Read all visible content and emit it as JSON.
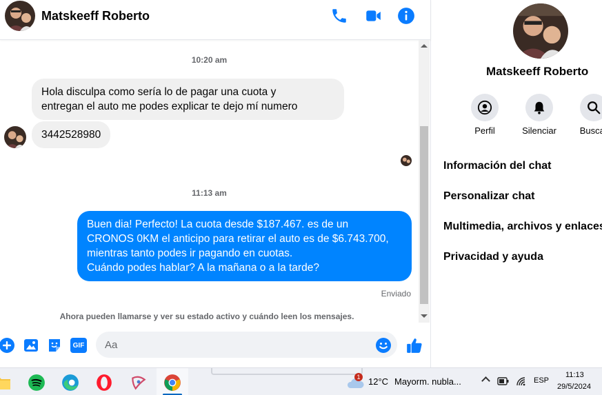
{
  "chat": {
    "contact_name": "Matskeeff Roberto",
    "header_icons": [
      "phone-icon",
      "video-camera-icon",
      "info-icon"
    ],
    "messages": [
      {
        "timestamp": "10:20 am"
      },
      {
        "direction": "incoming",
        "text_line1": "Hola disculpa como sería lo de pagar una cuota y",
        "text_line2": "entregan el auto me podes explicar te dejo mí numero"
      },
      {
        "direction": "incoming",
        "text": "3442528980"
      },
      {
        "timestamp": "11:13 am"
      },
      {
        "direction": "outgoing",
        "line1": "Buen dia! Perfecto! La cuota desde $187.467. es de un",
        "line2": "CRONOS 0KM el anticipo para retirar el auto es de $6.743.700,",
        "line3": "mientras tanto podes ir pagando en cuotas.",
        "line4": "Cuándo podes hablar? A la mañana o a la tarde?",
        "status": "Enviado"
      }
    ],
    "notice": "Ahora pueden llamarse y ver su estado activo y cuándo leen los mensajes.",
    "composer": {
      "placeholder": "Aa",
      "icons": [
        "plus-icon",
        "image-icon",
        "sticker-icon",
        "gif-icon",
        "emoji-icon",
        "thumbs-up-icon"
      ],
      "gif_label": "GIF"
    }
  },
  "panel": {
    "name": "Matskeeff Roberto",
    "actions": [
      {
        "label": "Perfil",
        "icon": "profile-icon"
      },
      {
        "label": "Silenciar",
        "icon": "bell-icon"
      },
      {
        "label": "Buscar",
        "icon": "search-icon"
      }
    ],
    "menu": [
      "Información del chat",
      "Personalizar chat",
      "Multimedia, archivos y enlaces",
      "Privacidad y ayuda"
    ]
  },
  "taskbar": {
    "apps": [
      "file-explorer-icon",
      "spotify-icon",
      "edge-icon",
      "opera-icon",
      "app-icon",
      "chrome-icon"
    ],
    "weather": {
      "temp": "12°C",
      "desc": "Mayorm. nubla...",
      "badge": "1"
    },
    "language": "ESP",
    "time": "11:13",
    "date": "29/5/2024"
  },
  "colors": {
    "accent": "#0084ff",
    "icon_blue": "#0a7cff"
  }
}
